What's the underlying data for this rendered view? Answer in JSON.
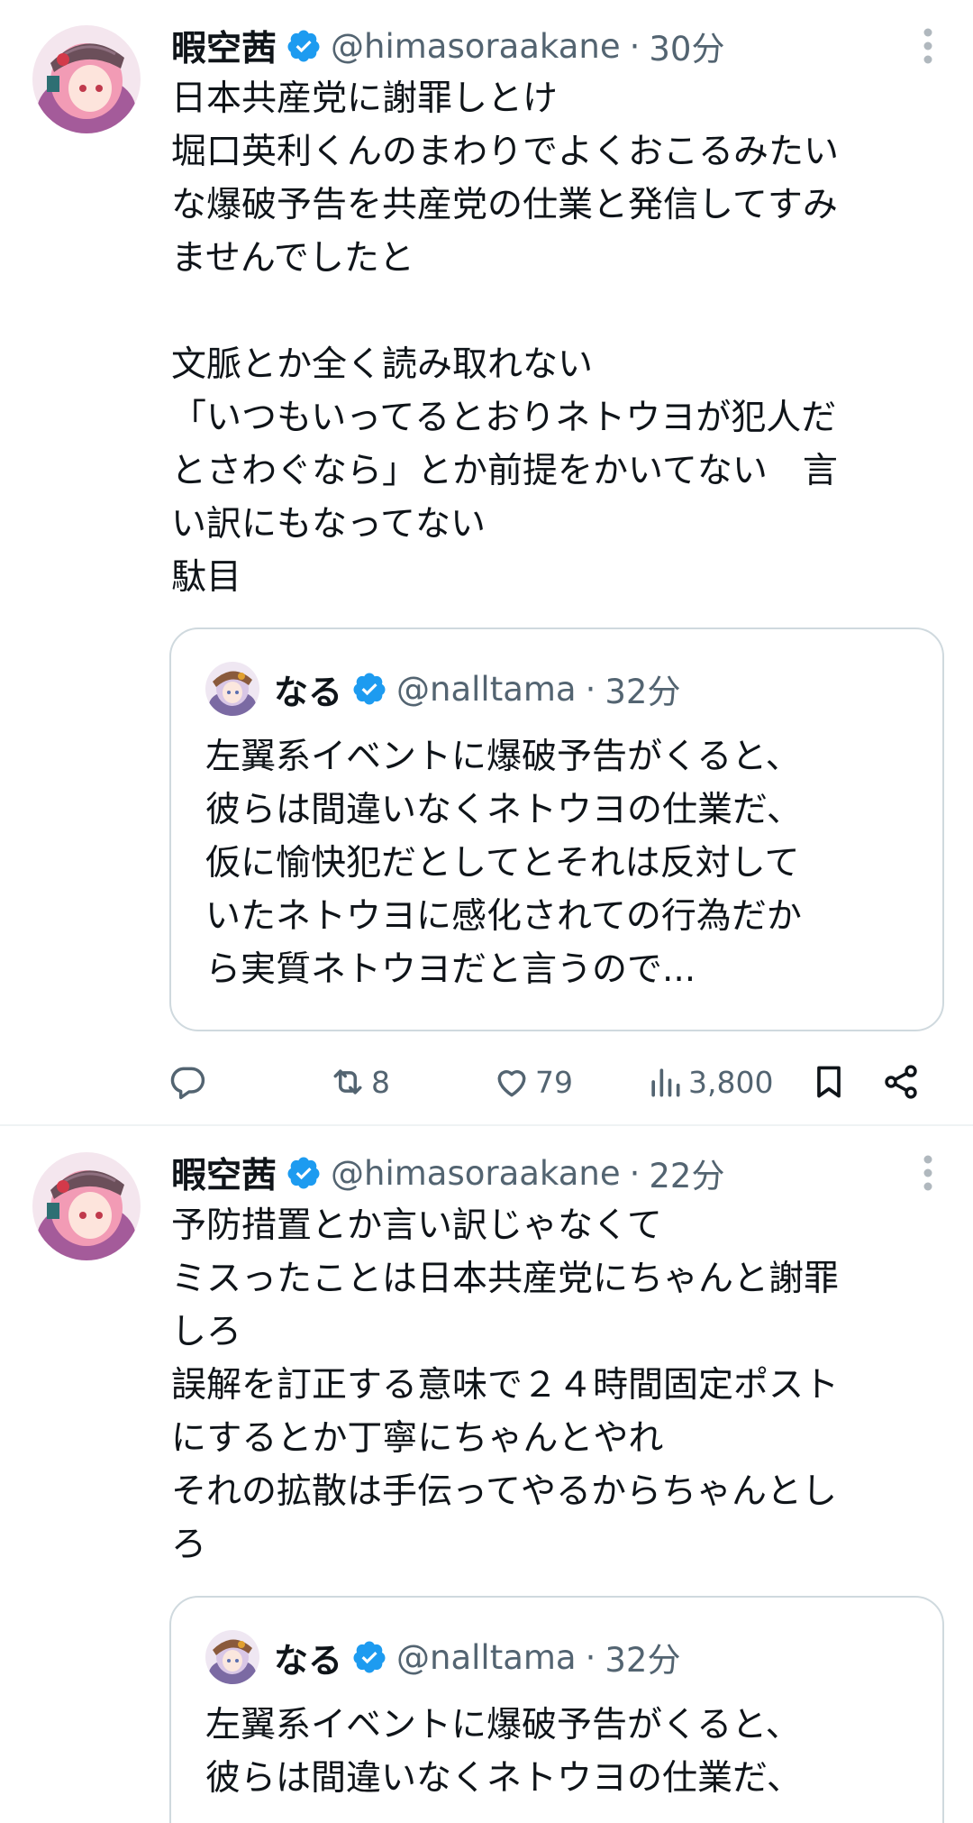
{
  "tweets": [
    {
      "author": {
        "name": "暇空茜",
        "handle": "@himasoraakane",
        "verified": true
      },
      "time": "30分",
      "text_lines": [
        "日本共産党に謝罪しとけ",
        "堀口英利くんのまわりでよくおこるみたい",
        "な爆破予告を共産党の仕業と発信してすみ",
        "ませんでしたと",
        "",
        "文脈とか全く読み取れない",
        "「いつもいってるとおりネトウヨが犯人だ",
        "とさわぐなら」とか前提をかいてない　言",
        "い訳にもなってない",
        "駄目"
      ],
      "quote": {
        "author": {
          "name": "なる",
          "handle": "@nalltama",
          "verified": true
        },
        "time": "32分",
        "text_lines": [
          "左翼系イベントに爆破予告がくると、",
          "彼らは間違いなくネトウヨの仕業だ、",
          "仮に愉快犯だとしてとそれは反対して",
          "いたネトウヨに感化されての行為だか",
          "ら実質ネトウヨだと言うので..."
        ]
      },
      "actions": {
        "reply_count": "",
        "retweet_count": "8",
        "like_count": "79",
        "view_count": "3,800"
      }
    },
    {
      "author": {
        "name": "暇空茜",
        "handle": "@himasoraakane",
        "verified": true
      },
      "time": "22分",
      "text_lines": [
        "予防措置とか言い訳じゃなくて",
        "ミスったことは日本共産党にちゃんと謝罪",
        "しろ",
        "誤解を訂正する意味で２４時間固定ポスト",
        "にするとか丁寧にちゃんとやれ",
        "それの拡散は手伝ってやるからちゃんとし",
        "ろ"
      ],
      "quote": {
        "author": {
          "name": "なる",
          "handle": "@nalltama",
          "verified": true
        },
        "time": "32分",
        "text_lines": [
          "左翼系イベントに爆破予告がくると、",
          "彼らは間違いなくネトウヨの仕業だ、"
        ]
      }
    }
  ],
  "separator": "·",
  "colors": {
    "text": "#0f1419",
    "secondary": "#536471",
    "verified": "#1d9bf0",
    "border": "#cfd9de"
  },
  "icons": [
    "verified-badge-icon",
    "more-icon",
    "reply-icon",
    "retweet-icon",
    "like-icon",
    "views-icon",
    "bookmark-icon",
    "share-icon"
  ]
}
